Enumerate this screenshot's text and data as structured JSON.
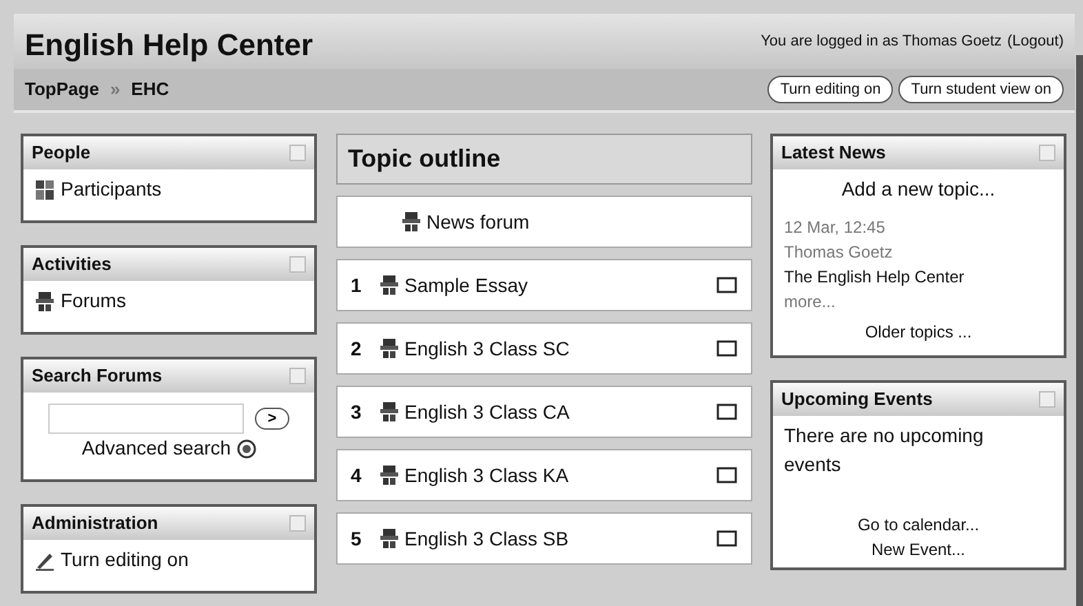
{
  "header": {
    "title": "English Help Center",
    "login_text": "You are logged in as Thomas Goetz",
    "logout": "(Logout)",
    "breadcrumb": [
      {
        "label": "TopPage"
      },
      {
        "label": "EHC"
      }
    ],
    "breadcrumb_separator": "»",
    "buttons": [
      "Turn editing on",
      "Turn student view on"
    ]
  },
  "left_blocks": [
    {
      "title": "People",
      "kind": "links",
      "items": [
        {
          "label": "Participants",
          "kind": "people"
        }
      ]
    },
    {
      "title": "Activities",
      "kind": "links",
      "items": [
        {
          "label": "Forums",
          "kind": "forum"
        }
      ]
    },
    {
      "title": "Search Forums",
      "kind": "search",
      "button": ">",
      "link": "Advanced search"
    },
    {
      "title": "Administration",
      "kind": "links",
      "items": [
        {
          "label": "Turn editing on",
          "kind": "edit"
        }
      ]
    }
  ],
  "topic_outline": {
    "title": "Topic outline",
    "sections": [
      {
        "label": "News forum"
      },
      {
        "number": "1",
        "label": "Sample Essay"
      },
      {
        "number": "2",
        "label": "English 3 Class SC"
      },
      {
        "number": "3",
        "label": "English 3 Class CA"
      },
      {
        "number": "4",
        "label": "English 3 Class KA"
      },
      {
        "number": "5",
        "label": "English 3 Class SB"
      }
    ]
  },
  "right_blocks": [
    {
      "title": "Latest News",
      "kind": "news",
      "add_link": "Add a new topic...",
      "date": "12 Mar, 12:45",
      "author": "Thomas Goetz",
      "subject": "The English Help Center",
      "more": "more...",
      "older": "Older topics ..."
    },
    {
      "title": "Upcoming Events",
      "kind": "events",
      "message": "There are no upcoming events",
      "links": [
        "Go to calendar...",
        "New Event..."
      ]
    }
  ]
}
